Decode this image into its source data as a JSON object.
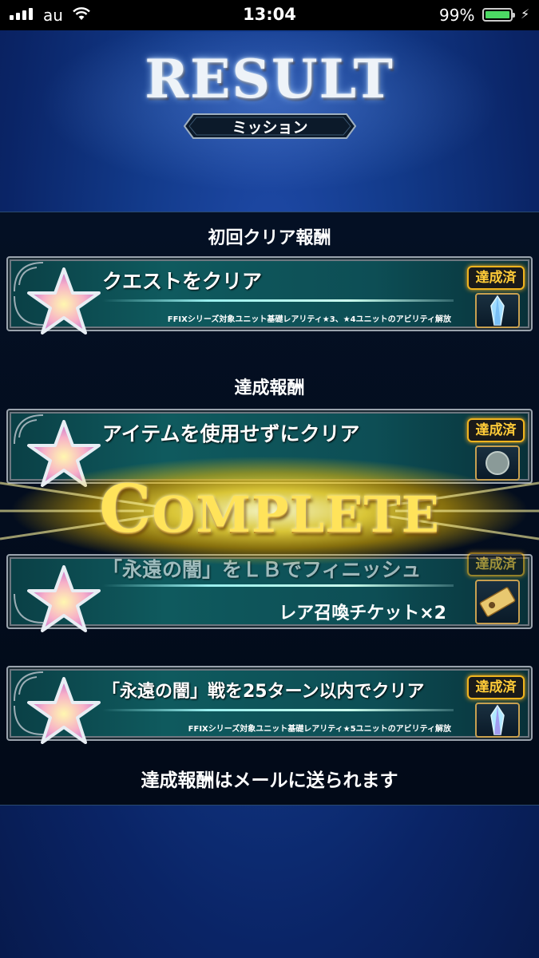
{
  "status_bar": {
    "carrier": "au",
    "time": "13:04",
    "battery": "99%",
    "battery_level": 0.99
  },
  "header": {
    "title": "RESULT",
    "subtitle": "ミッション"
  },
  "sections": {
    "first_clear": "初回クリア報酬",
    "achievement": "達成報酬"
  },
  "missions": [
    {
      "title": "クエストをクリア",
      "reward": "FFIXシリーズ対象ユニット基礎レアリティ★3、★4ユニットのアビリティ解放",
      "badge": "達成済",
      "item_icon": "crystal-icon"
    },
    {
      "title": "アイテムを使用せずにクリア",
      "reward": "",
      "badge": "達成済",
      "item_icon": "coin-icon"
    },
    {
      "title": "「永遠の闇」をＬＢでフィニッシュ",
      "reward": "レア召喚チケット×2",
      "badge": "達成済",
      "item_icon": "ticket-icon"
    },
    {
      "title": "「永遠の闇」戦を25ターン以内でクリア",
      "reward": "FFIXシリーズ対象ユニット基礎レアリティ★5ユニットのアビリティ解放",
      "badge": "達成済",
      "item_icon": "crystal-icon"
    }
  ],
  "footer_note": "達成報酬はメールに送られます",
  "overlay": {
    "first_letter": "C",
    "rest": "OMPLETE"
  },
  "colors": {
    "badge": "#ffcb38",
    "card": "#0f5a5e",
    "overlay": "#ffe35a"
  }
}
